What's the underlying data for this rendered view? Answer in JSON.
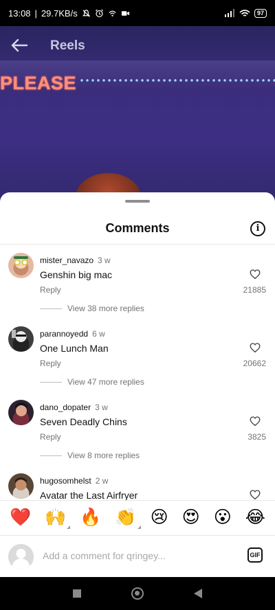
{
  "status_bar": {
    "time": "13:08",
    "speed": "29.7KB/s",
    "battery": "97"
  },
  "video": {
    "title": "Reels",
    "sign_text": "PLEASE"
  },
  "sheet": {
    "title": "Comments"
  },
  "comments": [
    {
      "username": "mister_navazo",
      "age": "3 w",
      "text": "Genshin big mac",
      "reply_label": "Reply",
      "likes": "21885",
      "replies_label": "View 38 more replies"
    },
    {
      "username": "parannoyedd",
      "age": "6 w",
      "text": "One Lunch Man",
      "reply_label": "Reply",
      "likes": "20662",
      "replies_label": "View 47 more replies"
    },
    {
      "username": "dano_dopater",
      "age": "3 w",
      "text": "Seven Deadly Chins",
      "reply_label": "Reply",
      "likes": "3825",
      "replies_label": "View 8 more replies"
    },
    {
      "username": "hugosomhelst",
      "age": "2 w",
      "text": "Avatar the Last Airfryer",
      "reply_label": "",
      "likes": "",
      "replies_label": ""
    }
  ],
  "reactions": [
    "❤️",
    "🙌",
    "🔥",
    "👏",
    "😢",
    "😍",
    "😮",
    "😂"
  ],
  "input": {
    "placeholder": "Add a comment for qringey...",
    "gif_label": "GIF"
  },
  "colors": {
    "secondary_text": "#737373",
    "divider": "#e6e6e6",
    "video_tint": "#3d2e84"
  },
  "icons": {
    "info": "info-circle-icon",
    "heart": "heart-outline-icon",
    "back": "arrow-left-icon"
  }
}
